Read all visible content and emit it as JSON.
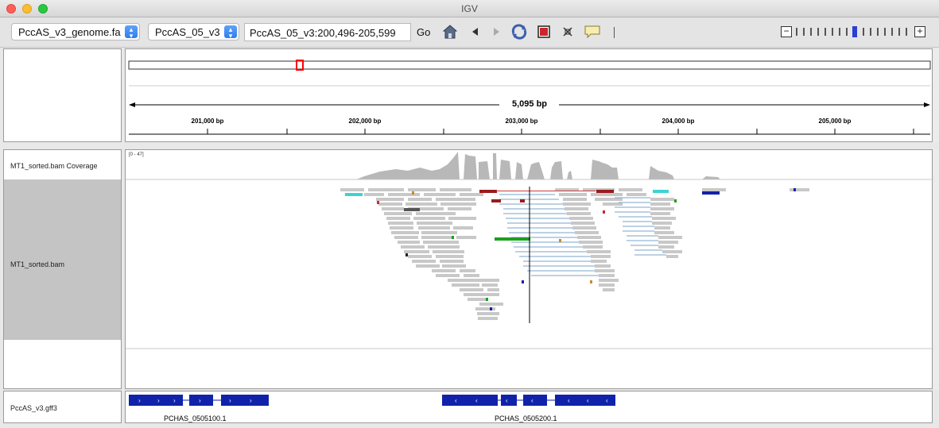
{
  "window": {
    "title": "IGV"
  },
  "toolbar": {
    "genome_select": "PccAS_v3_genome.fa",
    "chrom_select": "PccAS_05_v3",
    "locus": "PccAS_05_v3:200,496-205,599",
    "go_label": "Go",
    "icons": [
      "home-icon",
      "back-icon",
      "forward-icon",
      "refresh-icon",
      "roi-icon",
      "resize-icon",
      "popup-text-icon",
      "divider"
    ]
  },
  "ruler": {
    "span_label": "5,095 bp",
    "ticks": [
      "201,000 bp",
      "202,000 bp",
      "203,000 bp",
      "204,000 bp",
      "205,000 bp"
    ]
  },
  "tracks": {
    "coverage": {
      "name": "MT1_sorted.bam Coverage",
      "range": "[0 - 47]"
    },
    "alignments": {
      "name": "MT1_sorted.bam"
    },
    "annotation": {
      "name": "PccAS_v3.gff3",
      "genes": [
        "PCHAS_0505100.1",
        "PCHAS_0505200.1"
      ]
    }
  },
  "colors": {
    "gene": "#1122aa",
    "read": "#c8c8c8",
    "highlight": "#ff0000",
    "zoom_current": "#2a3fd6"
  }
}
